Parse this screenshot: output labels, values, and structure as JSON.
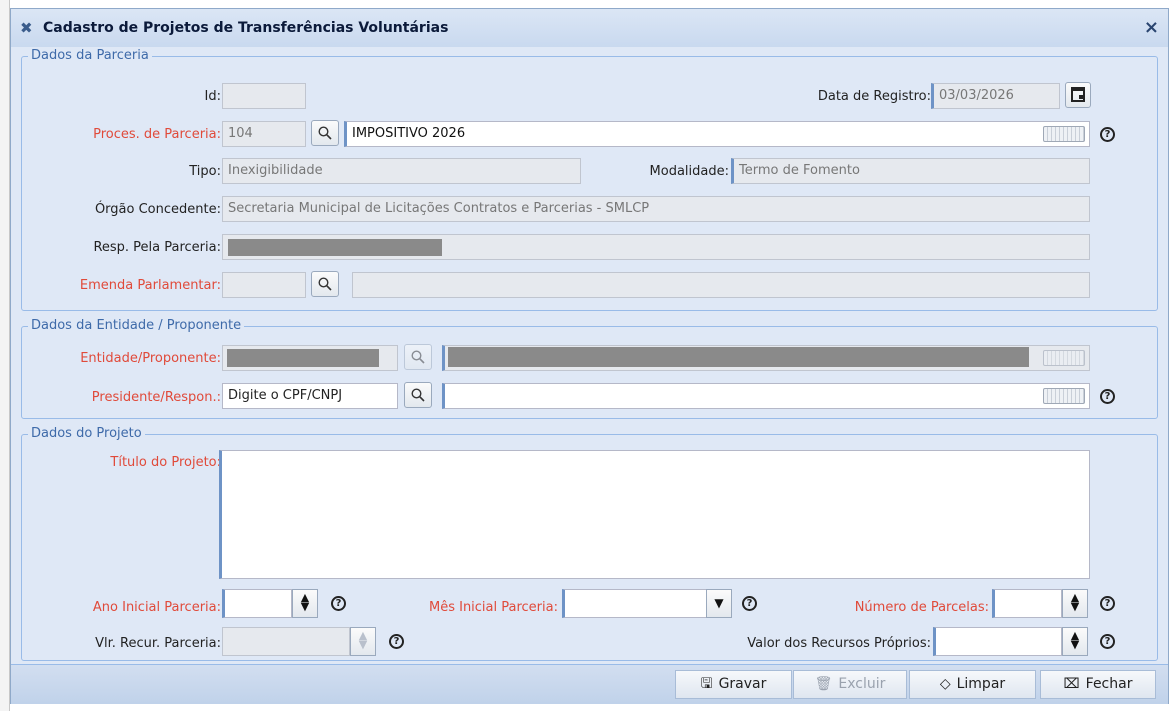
{
  "window": {
    "title": "Cadastro de Projetos de Transferências Voluntárias",
    "close_label": "×"
  },
  "dados_parceria": {
    "legend": "Dados da Parceria",
    "id_label": "Id:",
    "id_value": "",
    "data_registro_label": "Data de Registro:",
    "data_registro_value": "03/03/2026",
    "proces_label": "Proces. de Parceria:",
    "proces_code": "104",
    "proces_value": "IMPOSITIVO 2026",
    "tipo_label": "Tipo:",
    "tipo_value": "Inexigibilidade",
    "modalidade_label": "Modalidade:",
    "modalidade_value": "Termo de Fomento",
    "orgao_label": "Órgão Concedente:",
    "orgao_value": "Secretaria Municipal de Licitações Contratos e Parcerias - SMLCP",
    "resp_label": "Resp. Pela Parceria:",
    "resp_value": "",
    "emenda_label": "Emenda Parlamentar:",
    "emenda_code": "",
    "emenda_value": ""
  },
  "dados_entidade": {
    "legend": "Dados da Entidade / Proponente",
    "entidade_label": "Entidade/Proponente:",
    "presidente_label": "Presidente/Respon.:",
    "presidente_placeholder": "Digite o CPF/CNPJ",
    "presidente_name": ""
  },
  "dados_projeto": {
    "legend": "Dados do Projeto",
    "titulo_label": "Título do Projeto:",
    "titulo_value": "",
    "ano_label": "Ano Inicial Parceria:",
    "ano_value": "",
    "mes_label": "Mês Inicial Parceria:",
    "mes_value": "",
    "parcelas_label": "Número de Parcelas:",
    "parcelas_value": "",
    "vlr_label": "Vlr. Recur. Parceria:",
    "vlr_value": "",
    "proprios_label": "Valor dos Recursos Próprios:",
    "proprios_value": ""
  },
  "footer": {
    "gravar": "Gravar",
    "excluir": "Excluir",
    "limpar": "Limpar",
    "fechar": "Fechar"
  },
  "icons": {
    "search": "magnifier-icon",
    "help": "question-circle-icon",
    "keyboard": "virtual-keyboard-icon",
    "calendar": "calendar-icon",
    "spinner": "up-down-arrows-icon",
    "save": "floppy-disk-icon",
    "delete": "trash-icon",
    "clear": "eraser-icon",
    "close": "close-box-icon",
    "title": "tools-icon"
  },
  "colors": {
    "required_label": "#e04a3a",
    "legend": "#3e6aa9",
    "background": "#dfe8f6"
  }
}
